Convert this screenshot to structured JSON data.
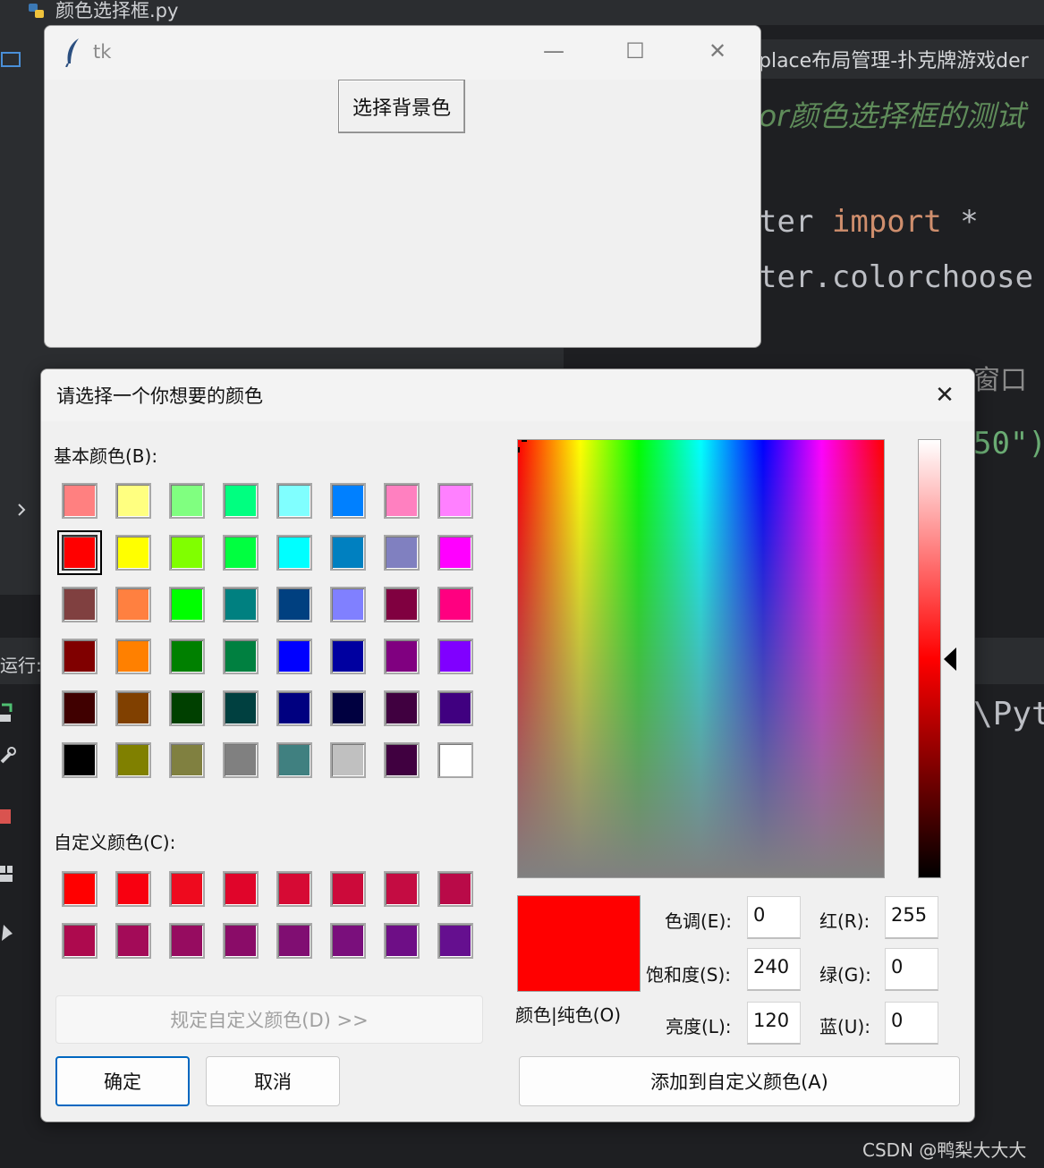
{
  "ide": {
    "file_tab": "颜色选择框.py",
    "editor_tab": "place布局管理-扑克牌游戏der",
    "comment": "or颜色选择框的测试",
    "code_line1_a": "ter ",
    "code_line1_kw": "import",
    "code_line1_b": " *",
    "code_line2": "ter.colorchoose",
    "code_line3": "窗口",
    "code_line4": "50\")",
    "run_label": "运行:",
    "run_output": "\\Pyt"
  },
  "tk_window": {
    "title": "tk",
    "minimize": "—",
    "maximize": "☐",
    "close": "✕",
    "button_label": "选择背景色"
  },
  "dialog": {
    "title": "请选择一个你想要的颜色",
    "close": "✕",
    "basic_colors_label": "基本颜色(B):",
    "custom_colors_label": "自定义颜色(C):",
    "basic_colors": [
      "#ff8080",
      "#ffff80",
      "#80ff80",
      "#00ff80",
      "#80ffff",
      "#0080ff",
      "#ff80c0",
      "#ff80ff",
      "#ff0000",
      "#ffff00",
      "#80ff00",
      "#00ff40",
      "#00ffff",
      "#0080c0",
      "#8080c0",
      "#ff00ff",
      "#804040",
      "#ff8040",
      "#00ff00",
      "#008080",
      "#004080",
      "#8080ff",
      "#800040",
      "#ff0080",
      "#800000",
      "#ff8000",
      "#008000",
      "#008040",
      "#0000ff",
      "#0000a0",
      "#800080",
      "#8000ff",
      "#400000",
      "#804000",
      "#004000",
      "#004040",
      "#000080",
      "#000040",
      "#400040",
      "#400080",
      "#000000",
      "#808000",
      "#808040",
      "#808080",
      "#408080",
      "#c0c0c0",
      "#400040",
      "#ffffff"
    ],
    "selected_basic_index": 8,
    "custom_colors": [
      "#ff0000",
      "#f80010",
      "#ee0a1e",
      "#e0052a",
      "#d60a34",
      "#cc0a3a",
      "#c40c42",
      "#b90a48",
      "#ad0a4e",
      "#a30b58",
      "#960c60",
      "#8a0c68",
      "#800e72",
      "#7a0f7c",
      "#6e0e86",
      "#650f8f"
    ],
    "define_custom_button": "规定自定义颜色(D) >>",
    "ok_button": "确定",
    "cancel_button": "取消",
    "preview_label": "颜色|纯色(O)",
    "hue_label": "色调(E):",
    "hue_value": "0",
    "sat_label": "饱和度(S):",
    "sat_value": "240",
    "lum_label": "亮度(L):",
    "lum_value": "120",
    "red_label": "红(R):",
    "red_value": "255",
    "green_label": "绿(G):",
    "green_value": "0",
    "blue_label": "蓝(U):",
    "blue_value": "0",
    "add_custom_button": "添加到自定义颜色(A)",
    "current_color": "#ff0000"
  },
  "watermark": "CSDN @鸭梨大大大"
}
